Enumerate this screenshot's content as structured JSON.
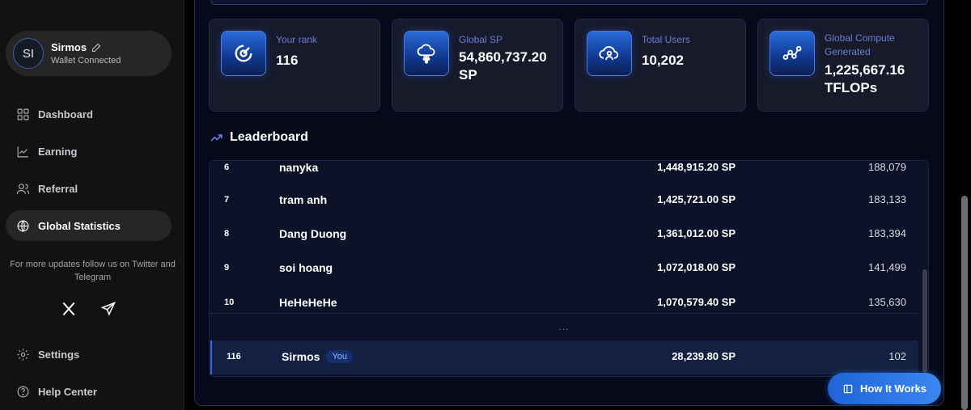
{
  "profile": {
    "initials": "SI",
    "name": "Sirmos",
    "status": "Wallet Connected"
  },
  "nav": {
    "dashboard": "Dashboard",
    "earning": "Earning",
    "referral": "Referral",
    "global_statistics": "Global Statistics",
    "settings": "Settings",
    "help_center": "Help Center"
  },
  "follow_text": "For more updates follow us on Twitter and Telegram",
  "stats": [
    {
      "label": "Your rank",
      "value": "116",
      "icon": "rank-icon"
    },
    {
      "label": "Global SP",
      "value": "54,860,737.20 SP",
      "icon": "cloud-network-icon"
    },
    {
      "label": "Total Users",
      "value": "10,202",
      "icon": "users-cloud-icon"
    },
    {
      "label": "Global Compute Generated",
      "value": "1,225,667.16 TFLOPs",
      "icon": "graph-nodes-icon"
    }
  ],
  "leaderboard": {
    "title": "Leaderboard",
    "partial_row": {
      "rank": "6",
      "name": "nanyka",
      "points": "1,448,915.20 SP",
      "refs": "188,079"
    },
    "rows": [
      {
        "rank": "7",
        "name": "tram anh",
        "points": "1,425,721.00 SP",
        "refs": "183,133"
      },
      {
        "rank": "8",
        "name": "Dang Duong",
        "points": "1,361,012.00 SP",
        "refs": "183,394"
      },
      {
        "rank": "9",
        "name": "soi hoang",
        "points": "1,072,018.00 SP",
        "refs": "141,499"
      },
      {
        "rank": "10",
        "name": "HeHeHeHe",
        "points": "1,070,579.40 SP",
        "refs": "135,630"
      }
    ],
    "ellipsis": "...",
    "you_row": {
      "rank": "116",
      "name": "Sirmos",
      "badge": "You",
      "points": "28,239.80 SP",
      "refs": "102"
    }
  },
  "how_it_works": "How It Works",
  "colors": {
    "accent": "#2f6fe0",
    "label": "#6f7dd0",
    "card_bg": "#161a2b",
    "sidebar_bg": "#121212"
  }
}
